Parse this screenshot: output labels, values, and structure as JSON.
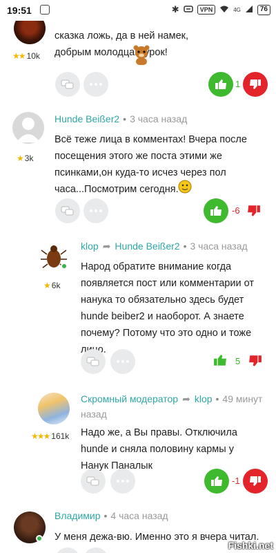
{
  "status_bar": {
    "time": "19:51",
    "bluetooth": "✱",
    "vpn": "VPN",
    "network": "4G",
    "battery": "76"
  },
  "colors": {
    "name": "#2fa7a7",
    "upvote": "#3fb92e",
    "downvote": "#e3242b",
    "button_bg": "#e9eaeb"
  },
  "comments": [
    {
      "karma": "10k",
      "text": "сказка ложь, да в ней намек, добрым молодцам урок!",
      "score": "1"
    },
    {
      "author": "Hunde Beißer2",
      "time": "3 часа назад",
      "karma": "3k",
      "text": "Всё теже лица в комментах! Вчера после посещения этого же поста этими же псинками,он куда-то исчез через пол часа...Посмотрим сегодня.",
      "score": "-6"
    },
    {
      "author": "klop",
      "reply_to": "Hunde Beißer2",
      "time": "3 часа назад",
      "karma": "6k",
      "text": "Народ обратите внимание когда появляется пост или комментарии от нанука то обязательно здесь будет hunde beiber2 и наоборот. А знаете почему? Потому что это одно и тоже лицо.",
      "score": "5"
    },
    {
      "author": "Скромный модератор",
      "reply_to": "klop",
      "time": "49 минут назад",
      "karma": "161k",
      "text": "Надо же, а Вы правы. Отключила hunde и сняла половину кармы у Нанук Паналык",
      "score": "-1"
    },
    {
      "author": "Владимир",
      "time": "4 часа назад",
      "text": "У меня дежа-вю. Именно это я вчера читал."
    }
  ],
  "watermark": "Fishki.net"
}
